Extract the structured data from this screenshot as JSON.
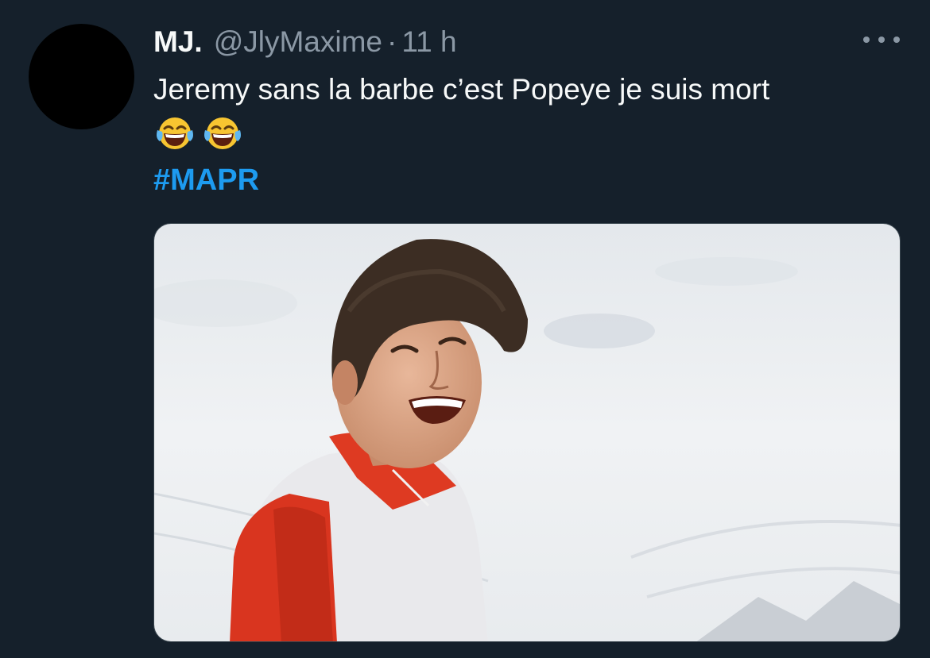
{
  "tweet": {
    "display_name": "MJ.",
    "handle": "@JlyMaxime",
    "separator": "·",
    "time": "11 h",
    "text": "Jeremy sans la barbe c’est Popeye je suis mort",
    "emojis": [
      "face-with-tears-of-joy",
      "face-with-tears-of-joy"
    ],
    "hashtag": "#MAPR"
  },
  "colors": {
    "background": "#15202b",
    "text": "#f7f9f9",
    "secondary": "#8b98a5",
    "link": "#1d9bf0"
  },
  "icons": {
    "more": "more-horizontal-icon"
  }
}
